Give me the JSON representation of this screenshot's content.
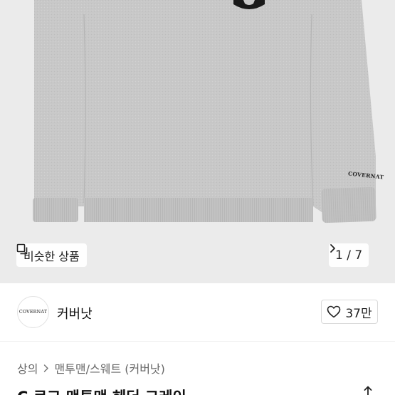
{
  "product_image": {
    "similar_label": "비슷한 상품",
    "page_indicator": "1 / 7",
    "sleeve_print": "COVERNAT",
    "colors": {
      "background": "#ebebeb",
      "sweatshirt": "#c9c9c9",
      "logo_patch": "#1a1a1a"
    }
  },
  "brand": {
    "logo_text": "COVERNAT",
    "name": "커버낫",
    "like_count": "37만"
  },
  "breadcrumb": {
    "items": [
      "상의",
      "맨투맨/스웨트 (커버낫)"
    ]
  },
  "product": {
    "title": "C 로고 맨투맨 헤더 그레이"
  },
  "icons": {
    "similar": "similar-items-icon",
    "next": "chevron-right-icon",
    "like": "heart-icon",
    "breadcrumb_separator": "chevron-right-icon",
    "share": "share-icon"
  }
}
